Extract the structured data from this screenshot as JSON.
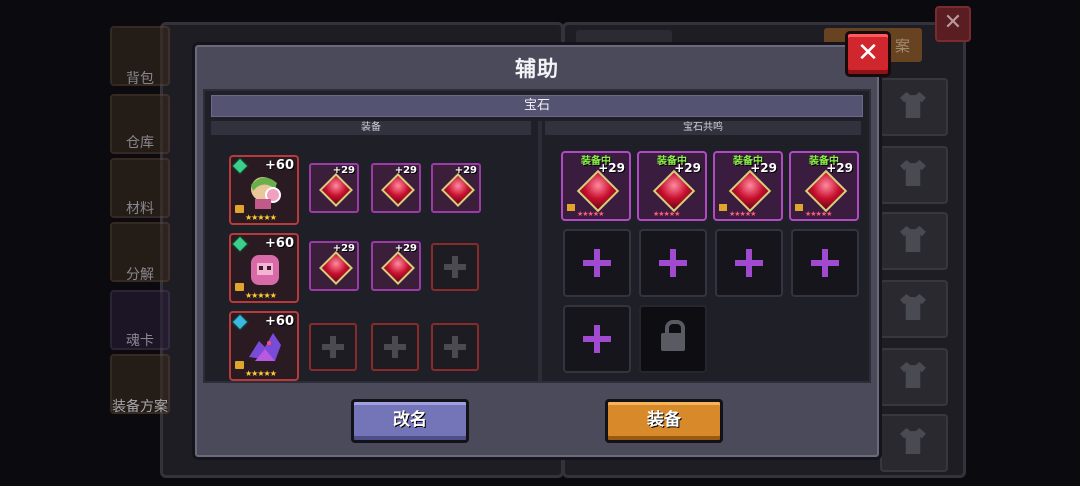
{
  "sidebar": {
    "items": [
      {
        "label": "背包"
      },
      {
        "label": "仓库"
      },
      {
        "label": "材料"
      },
      {
        "label": "分解"
      },
      {
        "label": "魂卡"
      },
      {
        "label": "装备方案"
      }
    ]
  },
  "background": {
    "orange_tab_label": "案",
    "close_label": "✕"
  },
  "modal": {
    "title": "辅助",
    "close_label": "✕",
    "section_label": "宝石",
    "left_header": "装备",
    "right_header": "宝石共鸣",
    "pets": [
      {
        "level": "+60",
        "stars": "★★★★★",
        "name": "girl-pet",
        "gems": [
          "+29",
          "+29",
          "+29"
        ]
      },
      {
        "level": "+60",
        "stars": "★★★★★",
        "name": "pink-ghost-pet",
        "gems": [
          "+29",
          "+29"
        ]
      },
      {
        "level": "+60",
        "stars": "★★★★★",
        "name": "purple-dragon-pet",
        "gems": []
      }
    ],
    "resonance": [
      {
        "status": "装备中",
        "level": "+29",
        "stars": "★★★★★"
      },
      {
        "status": "装备中",
        "level": "+29",
        "stars": "★★★★★"
      },
      {
        "status": "装备中",
        "level": "+29",
        "stars": "★★★★★"
      },
      {
        "status": "装备中",
        "level": "+29",
        "stars": "★★★★★"
      }
    ],
    "rename_button": "改名",
    "equip_button": "装备"
  },
  "colors": {
    "accent_red": "#d0262e",
    "gem_frame": "#b24ac4",
    "equipped_text": "#8cf04a",
    "rename_btn": "#7474b8",
    "equip_btn": "#d88a2a"
  }
}
